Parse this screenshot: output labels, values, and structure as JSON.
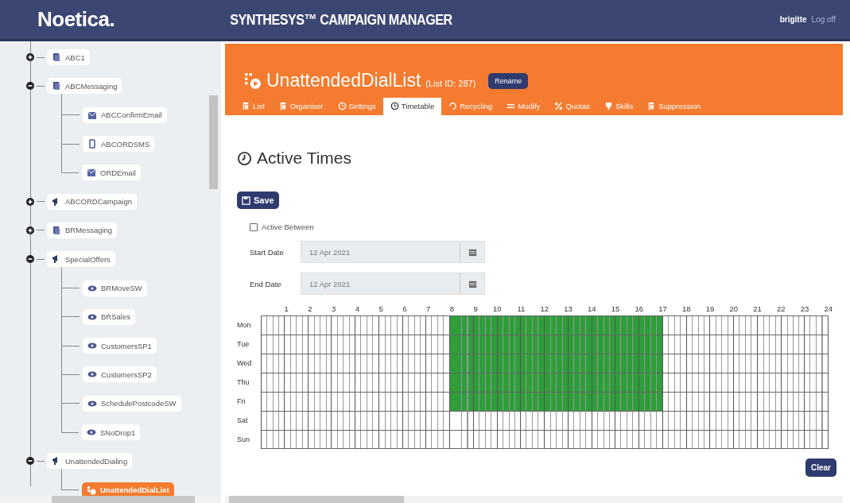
{
  "header": {
    "logo": "Noetica.",
    "title": "SYNTHESYS™ CAMPAIGN MANAGER",
    "user": "brigitte",
    "logoff": "Log off"
  },
  "tree": [
    {
      "label": "ABC1",
      "kind": "messaging",
      "expanded": false,
      "selected": false
    },
    {
      "label": "ABCMessaging",
      "kind": "messaging",
      "expanded": true,
      "selected": false,
      "children": [
        {
          "label": "ABCConfirmEmail",
          "kind": "email",
          "selected": false
        },
        {
          "label": "ABCORDSMS",
          "kind": "sms",
          "selected": false
        },
        {
          "label": "ORDEmail",
          "kind": "email",
          "selected": false
        }
      ]
    },
    {
      "label": "ABCORDCampaign",
      "kind": "campaign",
      "expanded": false,
      "selected": false
    },
    {
      "label": "BRMessaging",
      "kind": "messaging",
      "expanded": false,
      "selected": false
    },
    {
      "label": "SpecialOffers",
      "kind": "campaign",
      "expanded": true,
      "selected": false,
      "children": [
        {
          "label": "BRMoveSW",
          "kind": "list",
          "selected": false
        },
        {
          "label": "BRSales",
          "kind": "list",
          "selected": false
        },
        {
          "label": "CustomersSP1",
          "kind": "list",
          "selected": false
        },
        {
          "label": "CustomersSP2",
          "kind": "list",
          "selected": false
        },
        {
          "label": "SchedulePostcodeSW",
          "kind": "list",
          "selected": false
        },
        {
          "label": "SNoDrop1",
          "kind": "list",
          "selected": false
        }
      ]
    },
    {
      "label": "UnattendedDialing",
      "kind": "campaign",
      "expanded": true,
      "selected": false,
      "children": [
        {
          "label": "UnattendedDialList",
          "kind": "dial-list",
          "selected": true
        }
      ]
    }
  ],
  "list_header": {
    "name": "UnattendedDialList",
    "list_id": "(List ID: 287)",
    "rename": "Rename"
  },
  "tabs": [
    {
      "label": "List",
      "kind": "list",
      "selected": false
    },
    {
      "label": "Organiser",
      "kind": "organiser",
      "selected": false
    },
    {
      "label": "Settings",
      "kind": "settings",
      "selected": false
    },
    {
      "label": "Timetable",
      "kind": "timetable",
      "selected": true
    },
    {
      "label": "Recycling",
      "kind": "recycling",
      "selected": false
    },
    {
      "label": "Modify",
      "kind": "modify",
      "selected": false
    },
    {
      "label": "Quotas",
      "kind": "quotas",
      "selected": false
    },
    {
      "label": "Skills",
      "kind": "skills",
      "selected": false
    },
    {
      "label": "Suppression",
      "kind": "suppression",
      "selected": false
    }
  ],
  "section_title": "Active Times",
  "save": "Save",
  "active_between": {
    "label": "Active Between",
    "checked": false
  },
  "start_date": {
    "label": "Start Date",
    "value": "12 Apr 2021"
  },
  "end_date": {
    "label": "End Date",
    "value": "12 Apr 2021"
  },
  "timetable": {
    "hour_labels": [
      "1",
      "2",
      "3",
      "4",
      "5",
      "6",
      "7",
      "8",
      "9",
      "10",
      "11",
      "12",
      "13",
      "14",
      "15",
      "16",
      "17",
      "18",
      "19",
      "20",
      "21",
      "22",
      "23",
      "24"
    ],
    "days": [
      {
        "day": "Mon",
        "hours": [
          false,
          false,
          false,
          false,
          false,
          false,
          false,
          false,
          true,
          true,
          true,
          true,
          true,
          true,
          true,
          true,
          true,
          false,
          false,
          false,
          false,
          false,
          false,
          false
        ]
      },
      {
        "day": "Tue",
        "hours": [
          false,
          false,
          false,
          false,
          false,
          false,
          false,
          false,
          true,
          true,
          true,
          true,
          true,
          true,
          true,
          true,
          true,
          false,
          false,
          false,
          false,
          false,
          false,
          false
        ]
      },
      {
        "day": "Wed",
        "hours": [
          false,
          false,
          false,
          false,
          false,
          false,
          false,
          false,
          true,
          true,
          true,
          true,
          true,
          true,
          true,
          true,
          true,
          false,
          false,
          false,
          false,
          false,
          false,
          false
        ]
      },
      {
        "day": "Thu",
        "hours": [
          false,
          false,
          false,
          false,
          false,
          false,
          false,
          false,
          true,
          true,
          true,
          true,
          true,
          true,
          true,
          true,
          true,
          false,
          false,
          false,
          false,
          false,
          false,
          false
        ]
      },
      {
        "day": "Fri",
        "hours": [
          false,
          false,
          false,
          false,
          false,
          false,
          false,
          false,
          true,
          true,
          true,
          true,
          true,
          true,
          true,
          true,
          true,
          false,
          false,
          false,
          false,
          false,
          false,
          false
        ]
      },
      {
        "day": "Sat",
        "hours": [
          false,
          false,
          false,
          false,
          false,
          false,
          false,
          false,
          false,
          false,
          false,
          false,
          false,
          false,
          false,
          false,
          false,
          false,
          false,
          false,
          false,
          false,
          false,
          false
        ]
      },
      {
        "day": "Sun",
        "hours": [
          false,
          false,
          false,
          false,
          false,
          false,
          false,
          false,
          false,
          false,
          false,
          false,
          false,
          false,
          false,
          false,
          false,
          false,
          false,
          false,
          false,
          false,
          false,
          false
        ]
      }
    ]
  },
  "clear": "Clear"
}
